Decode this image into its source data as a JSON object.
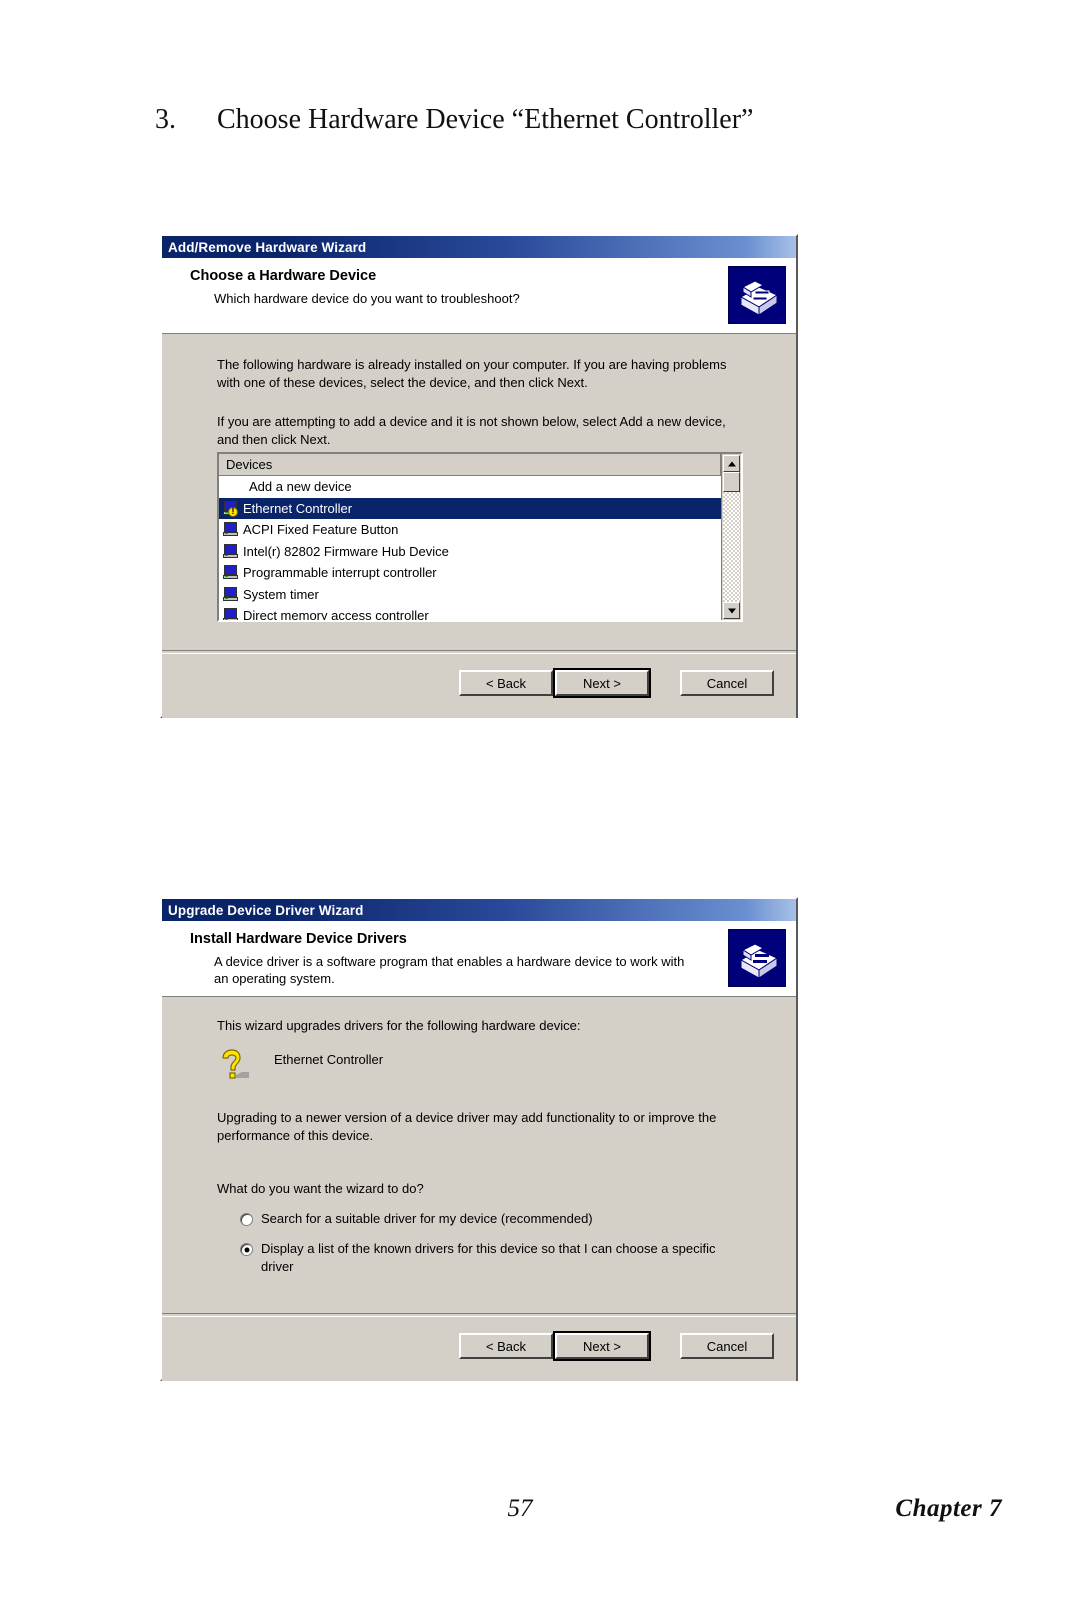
{
  "document": {
    "heading_number": "3.",
    "heading_text": "Choose Hardware Device “Ethernet Controller”",
    "page_number": "57",
    "chapter_label": "Chapter 7"
  },
  "dialog1": {
    "titlebar": "Add/Remove Hardware Wizard",
    "header_title": "Choose a Hardware Device",
    "header_subtitle": "Which hardware device do you want to troubleshoot?",
    "paragraph1": "The following hardware is already installed on your computer. If you are having problems with one of these devices, select the device, and then click Next.",
    "paragraph2": "If you are attempting to add a device and it is not shown below, select Add a new device, and then click Next.",
    "list": {
      "column_header": "Devices",
      "items": [
        {
          "label": "Add a new device",
          "icon": "none",
          "selected": false
        },
        {
          "label": "Ethernet Controller",
          "icon": "device-warning-icon",
          "selected": true
        },
        {
          "label": "ACPI Fixed Feature Button",
          "icon": "computer-icon",
          "selected": false
        },
        {
          "label": "Intel(r) 82802 Firmware Hub Device",
          "icon": "computer-icon",
          "selected": false
        },
        {
          "label": "Programmable interrupt controller",
          "icon": "computer-icon",
          "selected": false
        },
        {
          "label": "System timer",
          "icon": "computer-icon",
          "selected": false
        },
        {
          "label": "Direct memory access controller",
          "icon": "computer-icon",
          "selected": false
        }
      ]
    },
    "buttons": {
      "back": "< Back",
      "next": "Next >",
      "cancel": "Cancel"
    }
  },
  "dialog2": {
    "titlebar": "Upgrade Device Driver Wizard",
    "header_title": "Install Hardware Device Drivers",
    "header_subtitle": "A device driver is a software program that enables a hardware device to work with an operating system.",
    "paragraph1": "This wizard upgrades drivers for the following hardware device:",
    "device_name": "Ethernet Controller",
    "paragraph2": "Upgrading to a newer version of a device driver may add functionality to or improve the performance of this device.",
    "question": "What do you want the wizard to do?",
    "options": [
      {
        "label": "Search for a suitable driver for my device (recommended)",
        "selected": false
      },
      {
        "label": "Display a list of the known drivers for this device so that I can choose a specific driver",
        "selected": true
      }
    ],
    "buttons": {
      "back": "< Back",
      "next": "Next >",
      "cancel": "Cancel"
    }
  },
  "colors": {
    "titlebar_dark": "#0a246a",
    "dialog_face": "#d4d0c8",
    "selection": "#0a246a",
    "banner_icon_bg": "#00007a",
    "warning_yellow": "#ffe400"
  }
}
